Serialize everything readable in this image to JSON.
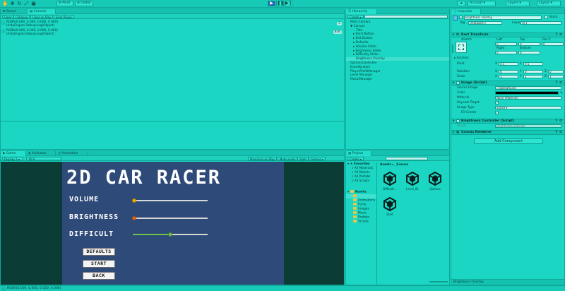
{
  "toolbar": {
    "pivot_label": "Pivot",
    "global_label": "Global",
    "twod_label": "2D",
    "account_label": "Account",
    "layers_label": "Layers",
    "layout_label": "Layout"
  },
  "scene_panel": {
    "tabs": [
      "Scene",
      "Console"
    ],
    "console_buttons": [
      "Clear",
      "Collapse",
      "Clear on Play",
      "Error Pause"
    ],
    "log_entries": [
      {
        "line1": "RGBA(0.000, 0.000, 0.000, 0.000)",
        "line2": "UnityEngine.Debug:Log(Object)",
        "count": "2"
      },
      {
        "line1": "RGBA(0.000, 0.000, 0.000, 0.000)",
        "line2": "UnityEngine.Debug:Log(Object)",
        "count": "836"
      }
    ]
  },
  "hierarchy": {
    "tab": "Hierarchy",
    "create_label": "Create",
    "items": [
      {
        "label": "Main Camera",
        "indent": 0,
        "selected": false
      },
      {
        "label": "▼ Canvas",
        "indent": 0,
        "selected": false
      },
      {
        "label": "Title",
        "indent": 2,
        "selected": false
      },
      {
        "label": "▸ Start Button",
        "indent": 1,
        "selected": false
      },
      {
        "label": "▸ Exit Button",
        "indent": 1,
        "selected": false
      },
      {
        "label": "▸ Defaults",
        "indent": 1,
        "selected": false
      },
      {
        "label": "▸ Volume Slider",
        "indent": 1,
        "selected": false
      },
      {
        "label": "▸ Brightness Slider",
        "indent": 1,
        "selected": false
      },
      {
        "label": "▸ Difficulty Slider",
        "indent": 1,
        "selected": false
      },
      {
        "label": "Brightness Overlay",
        "indent": 2,
        "selected": true
      },
      {
        "label": "OptionsController",
        "indent": 0,
        "selected": false
      },
      {
        "label": "EventSystem",
        "indent": 0,
        "selected": false
      },
      {
        "label": "PlayerPrefsManager",
        "indent": 0,
        "selected": false
      },
      {
        "label": "Level Manager",
        "indent": 0,
        "selected": false
      },
      {
        "label": "MusicManager",
        "indent": 0,
        "selected": false
      }
    ]
  },
  "inspector": {
    "tab": "Inspector",
    "object_name": "Brightness Overlay",
    "static_label": "Static",
    "tag_label": "Tag",
    "tag_value": "Untagged",
    "layer_label": "Layer",
    "layer_value": "UI",
    "rect_transform": "Rect Transform",
    "stretch_label": "stretch",
    "col_left": "Left",
    "col_top": "Top",
    "col_posz": "Pos Z",
    "val_left": "0",
    "val_top": "0",
    "val_posz": "0",
    "col_right": "Right",
    "col_bottom": "Bottom",
    "val_right": "0",
    "val_bottom": "0",
    "anchors_label": "▸ Anchors",
    "pivot_label": "Pivot",
    "pivot_x": "0.5",
    "pivot_y": "0.5",
    "rotation_label": "Rotation",
    "rot_x": "0",
    "rot_y": "0",
    "rot_z": "0",
    "scale_label": "Scale",
    "scale_x": "1",
    "scale_y": "1",
    "scale_z": "1",
    "image_script": "Image (Script)",
    "source_image_label": "Source Image",
    "source_image_value": "Background",
    "color_label": "Color",
    "color_value": "#000000",
    "material_label": "Material",
    "material_value": "None (Material)",
    "raycast_label": "Raycast Target",
    "image_type_label": "Image Type",
    "image_type_value": "Sliced",
    "fill_center_label": "Fill Center",
    "brightness_controller": "Brightness Controller (Script)",
    "script_label": "Script",
    "script_value": "BrightnessController",
    "canvas_renderer": "Canvas Renderer",
    "add_component": "Add Component",
    "footer_label": "Brightness Overlay"
  },
  "game_panel": {
    "tabs": [
      "Game",
      "Animator",
      "Animation"
    ],
    "display_label": "Display 1",
    "aspect_label": "16:9",
    "maximize_label": "Maximize on Play",
    "mute_label": "Mute audio",
    "stats_label": "Stats",
    "gizmos_label": "Gizmos",
    "title": "2D CAR RACER",
    "volume_label": "VOLUME",
    "brightness_label": "BRIGHTNESS",
    "difficulty_label": "DIFFICULT",
    "volume_value": 0.02,
    "brightness_value": 0.02,
    "difficulty_value": 0.5,
    "defaults_button": "DEFAULTS",
    "start_button": "START",
    "back_button": "BACK"
  },
  "project_panel": {
    "tab": "Project",
    "create_label": "Create",
    "favorites_label": "Favorites",
    "favorites": [
      "All Materials",
      "All Models",
      "All Prefabs",
      "All Scripts"
    ],
    "assets_label": "Assets",
    "folders": [
      "Animations",
      "Fonts",
      "Images",
      "Music",
      "Prefabs",
      "Scripts"
    ],
    "breadcrumb": "Assets ▸ _Scenes",
    "scenes": [
      "Difficult...",
      "Level_01",
      "Options",
      "Start"
    ]
  },
  "status_bar": {
    "message": "RGBA(0.000, 0.000, 0.000, 0.000)"
  },
  "colors": {
    "editor_bg": "#1ad6c3",
    "game_canvas": "#2e4a78",
    "volume_knob": "#f0b400",
    "brightness_knob": "#e86a1c",
    "difficulty_fill": "#6cc24a"
  }
}
